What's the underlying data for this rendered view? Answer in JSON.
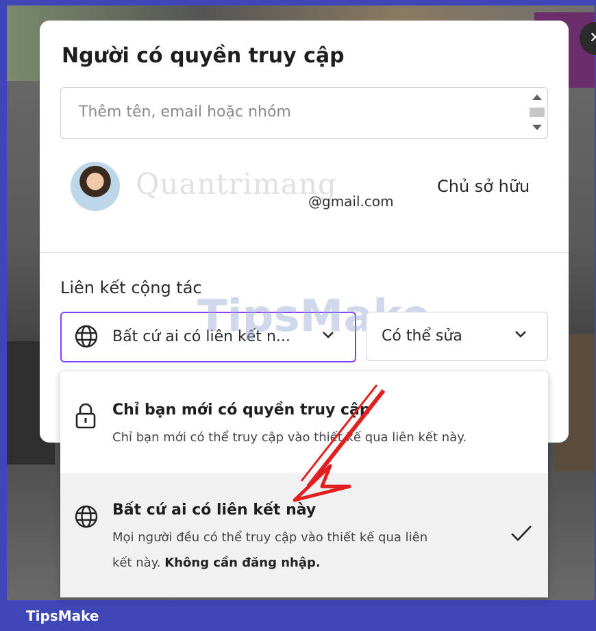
{
  "dialog": {
    "title": "Người có quyền truy cập",
    "search": {
      "placeholder": "Thêm tên, email hoặc nhóm",
      "value": ""
    },
    "user": {
      "email": "@gmail.com",
      "role": "Chủ sở hữu"
    },
    "link_section": {
      "label": "Liên kết cộng tác",
      "access_select": {
        "value": "Bất cứ ai có liên kết n...",
        "icon": "globe-icon"
      },
      "permission_select": {
        "value": "Có thể sửa",
        "icon": "chevron-down-icon"
      }
    }
  },
  "dropdown": {
    "options": [
      {
        "icon": "lock-icon",
        "title": "Chỉ bạn mới có quyền truy cập",
        "desc": "Chỉ bạn mới có thể truy cập vào thiết kế qua liên kết này."
      },
      {
        "icon": "globe-icon",
        "title": "Bất cứ ai có liên kết này",
        "desc_line1": "Mọi người đều có thể truy cập vào thiết kế qua liên",
        "desc_line2_prefix": "kết này. ",
        "desc_line2_bold": "Không cần đăng nhập.",
        "selected": true
      }
    ]
  },
  "watermarks": {
    "quantrimang": "Quantrimang",
    "tipsmake": "TipsMake"
  },
  "footer": {
    "brand": "TipsMake"
  },
  "colors": {
    "accent": "#8b3dff",
    "frame": "#3e46b8",
    "arrow": "#e02020"
  }
}
